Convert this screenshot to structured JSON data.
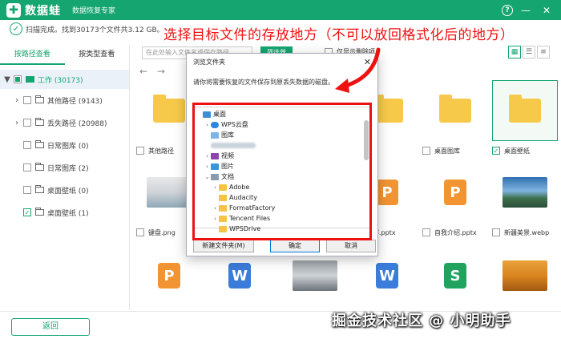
{
  "app": {
    "logo_glyph": "✚",
    "title": "数据蛙",
    "subtitle": "数据恢复专家",
    "help_glyph": "?",
    "minimize_glyph": "—",
    "close_glyph": "✕",
    "brand_color": "#14a571"
  },
  "status": {
    "check_glyph": "✓",
    "text": "扫描完成。找到30173个文件共3.12 GB。"
  },
  "annotation": {
    "text": "选择目标文件的存放地方（不可以放回格式化后的地方）",
    "color": "#ee1111"
  },
  "left_tabs": {
    "by_path": "按路径查看",
    "by_type": "按类型查看"
  },
  "tree": {
    "root": {
      "label": "工作 (30173)",
      "toggle": "▼"
    },
    "items": [
      {
        "label": "其他路径 (9143)",
        "toggle": "›",
        "checked": false
      },
      {
        "label": "丢失路径 (20988)",
        "toggle": "›",
        "checked": false
      },
      {
        "label": "日常图库 (0)",
        "toggle": "",
        "checked": false
      },
      {
        "label": "日常图库 (2)",
        "toggle": "",
        "checked": false
      },
      {
        "label": "桌面壁纸 (0)",
        "toggle": "",
        "checked": false
      },
      {
        "label": "桌面壁纸 (1)",
        "toggle": "",
        "checked": true
      }
    ]
  },
  "toolbar": {
    "search_placeholder": "在此处输入文件名或保存路径",
    "filter_label": "筛选器",
    "show_deleted_label": "仅显示删除项",
    "view_icons": [
      "▦",
      "☰",
      "≡"
    ],
    "back_arrow": "←",
    "forward_arrow": "→"
  },
  "files": {
    "row1": [
      {
        "name": "其他路径",
        "checked": false
      },
      {
        "name": "桌面图库",
        "checked": false
      },
      {
        "name": "桌面壁纸",
        "checked": true
      }
    ],
    "row2": [
      {
        "name": "键盘.png",
        "checked": false
      },
      {
        "name": "讲解.pptx",
        "checked": false
      },
      {
        "name": "自我介绍.pptx",
        "checked": false
      },
      {
        "name": "新疆美景.webp",
        "checked": false
      }
    ],
    "office_glyphs": {
      "p": "P",
      "w": "W",
      "s": "S"
    }
  },
  "dialog": {
    "title": "浏览文件夹",
    "close_glyph": "✕",
    "description": "请你将需要恢复的文件保存到原丢失数据的磁盘。",
    "tree": [
      {
        "label": "桌面",
        "caret": "",
        "indent": 0,
        "icon": "desk"
      },
      {
        "label": "WPS云盘",
        "caret": "›",
        "indent": 1,
        "icon": "cloud"
      },
      {
        "label": "图库",
        "caret": "",
        "indent": 1,
        "icon": "gal"
      },
      {
        "label": "",
        "caret": "",
        "indent": 1,
        "icon": "blur"
      },
      {
        "label": "视频",
        "caret": "›",
        "indent": 1,
        "icon": "vid"
      },
      {
        "label": "图片",
        "caret": "›",
        "indent": 1,
        "icon": "pic"
      },
      {
        "label": "文档",
        "caret": "⌄",
        "indent": 1,
        "icon": "doc"
      },
      {
        "label": "Adobe",
        "caret": "›",
        "indent": 2,
        "icon": "fold"
      },
      {
        "label": "Audacity",
        "caret": "",
        "indent": 2,
        "icon": "fold"
      },
      {
        "label": "FormatFactory",
        "caret": "›",
        "indent": 2,
        "icon": "fold"
      },
      {
        "label": "Tencent Files",
        "caret": "›",
        "indent": 2,
        "icon": "fold"
      },
      {
        "label": "WPSDrive",
        "caret": "",
        "indent": 2,
        "icon": "fold"
      }
    ],
    "new_folder_label": "新建文件夹(M)",
    "ok_label": "确定",
    "cancel_label": "取消"
  },
  "bottom": {
    "back_label": "返回",
    "watermark": "掘金技术社区 @ 小明助手"
  }
}
